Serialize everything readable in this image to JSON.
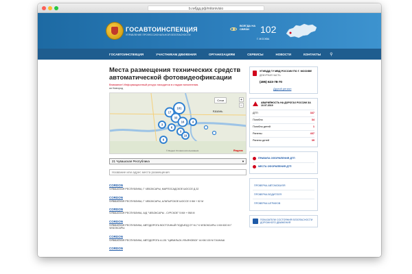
{
  "browser": {
    "url": "b.гибдд.рф/mitonivisio"
  },
  "header": {
    "title": "ГОСАВТОИНСПЕКЦИЯ",
    "subtitle": "УПРАВЛЕНИЕ ПРОФЕССИОНАЛЬНОЙ БЕЗОПАСНОСТИ",
    "hotline_label": "ВСЕГДА НА СВЯЗИ",
    "hotline_number": "102",
    "hotline_city": "Г. МОСКВА",
    "colors": {
      "header_from": "#1d6aa3",
      "header_to": "#3d93cf",
      "nav": "#1f5d8f",
      "accent_red": "#d0021b",
      "link": "#1e5aa8"
    }
  },
  "nav": {
    "items": [
      "ГОСАВТОИНСПЕКЦИЯ",
      "УЧАСТНИКАМ ДВИЖЕНИЯ",
      "ОРГАНИЗАЦИЯМ",
      "СЕРВИСЫ",
      "НОВОСТИ",
      "КОНТАКТЫ"
    ],
    "search_icon": "search-icon"
  },
  "main": {
    "title": "Места размещения технических средств автоматической фотовидеофиксации",
    "warning": "Внимание! Информационный ресурс находится в стадии наполнения.",
    "region_note": "ии Новгород",
    "map": {
      "layer_button": "Слои",
      "city": "Казань",
      "copyright": "© Яндекс Условия использования",
      "logo": "Яндекс",
      "clusters": [
        {
          "label": "101",
          "size": "large"
        },
        {
          "label": "17",
          "size": "mid"
        },
        {
          "label": "33",
          "size": "mid"
        },
        {
          "label": "16",
          "size": "mid"
        },
        {
          "label": "4",
          "size": "small"
        },
        {
          "label": "3",
          "size": "small"
        },
        {
          "label": "6",
          "size": "small"
        },
        {
          "label": "3",
          "size": "small"
        },
        {
          "label": "19",
          "size": "small"
        },
        {
          "label": "6",
          "size": "small"
        }
      ]
    },
    "region_select": "21 Чувашская Республика",
    "search_placeholder": "Название или адрес места размещения",
    "results": [
      {
        "name": "CORDON",
        "address": "ЧУВАШСКАЯ РЕСПУБЛИКА, Г ЧЕБОКСАРЫ, МАРПОСАДСКОЕ ШОССЕ Д.32"
      },
      {
        "name": "CORDON",
        "address": "ЧУВАШСКАЯ РЕСПУБЛИКА, Г ЧЕБОКСАРЫ, АЛАТЫРСКОЕ ШОССЕ 0 КМ + 52 М"
      },
      {
        "name": "CORDON",
        "address": "ЧУВАШСКАЯ РЕСПУБЛИКА, А/Д \"ЧЕБОКСАРЫ - СУРСКОЕ\" 5 КМ + 958 М"
      },
      {
        "name": "CORDON",
        "address": "ЧУВАШСКАЯ РЕСПУБЛИКА, АВТОДОРОГА ВОСТОЧНЫЙ ПОДЪЕЗД ОТ М-7 К ЧЕБОКСАРЫ 1 КМ 600 М Г ЧЕБОКСАРЫ"
      },
      {
        "name": "CORDON",
        "address": "ЧУВАШСКАЯ РЕСПУБЛИКА, АВТОДОРОГА А-151 \"ЦИВИЛЬСК-УЛЬЯНОВСК\" 44 КМ 100 М Г.КАНАШ"
      },
      {
        "name": "CORDON",
        "address": ""
      }
    ]
  },
  "sidebar": {
    "department": "УГИБДД ГУ МВД РОССИИ ПО Г. МОСКВЕ",
    "duty": "ДЕЖУРНАЯ ЧАСТЬ:",
    "phone": "(495) 623-78-70",
    "other_region": "Другой регион",
    "stats": {
      "title": "АВАРИЙНОСТЬ НА ДОРОГАХ РОССИИ ЗА 10.07.2019",
      "rows": [
        {
          "label": "ДТП",
          "value": "337"
        },
        {
          "label": "Погибло",
          "value": "34"
        },
        {
          "label": "Погибло детей",
          "value": "1"
        },
        {
          "label": "Ранены",
          "value": "437"
        },
        {
          "label": "Ранено детей",
          "value": "39"
        }
      ]
    },
    "dtp_links": [
      "ПРАВИЛА ОФОРМЛЕНИЯ ДТП",
      "МЕСТА ОФОРМЛЕНИЯ ДТП"
    ],
    "checks": [
      "ПРОВЕРКА АВТОМОБИЛЯ",
      "ПРОВЕРКА ВОДИТЕЛЯ",
      "ПРОВЕРКА ШТРАФОВ"
    ],
    "indicators": "ПОКАЗАТЕЛИ СОСТОЯНИЯ БЕЗОПАСНОСТИ ДОРОЖНОГО ДВИЖЕНИЯ"
  }
}
